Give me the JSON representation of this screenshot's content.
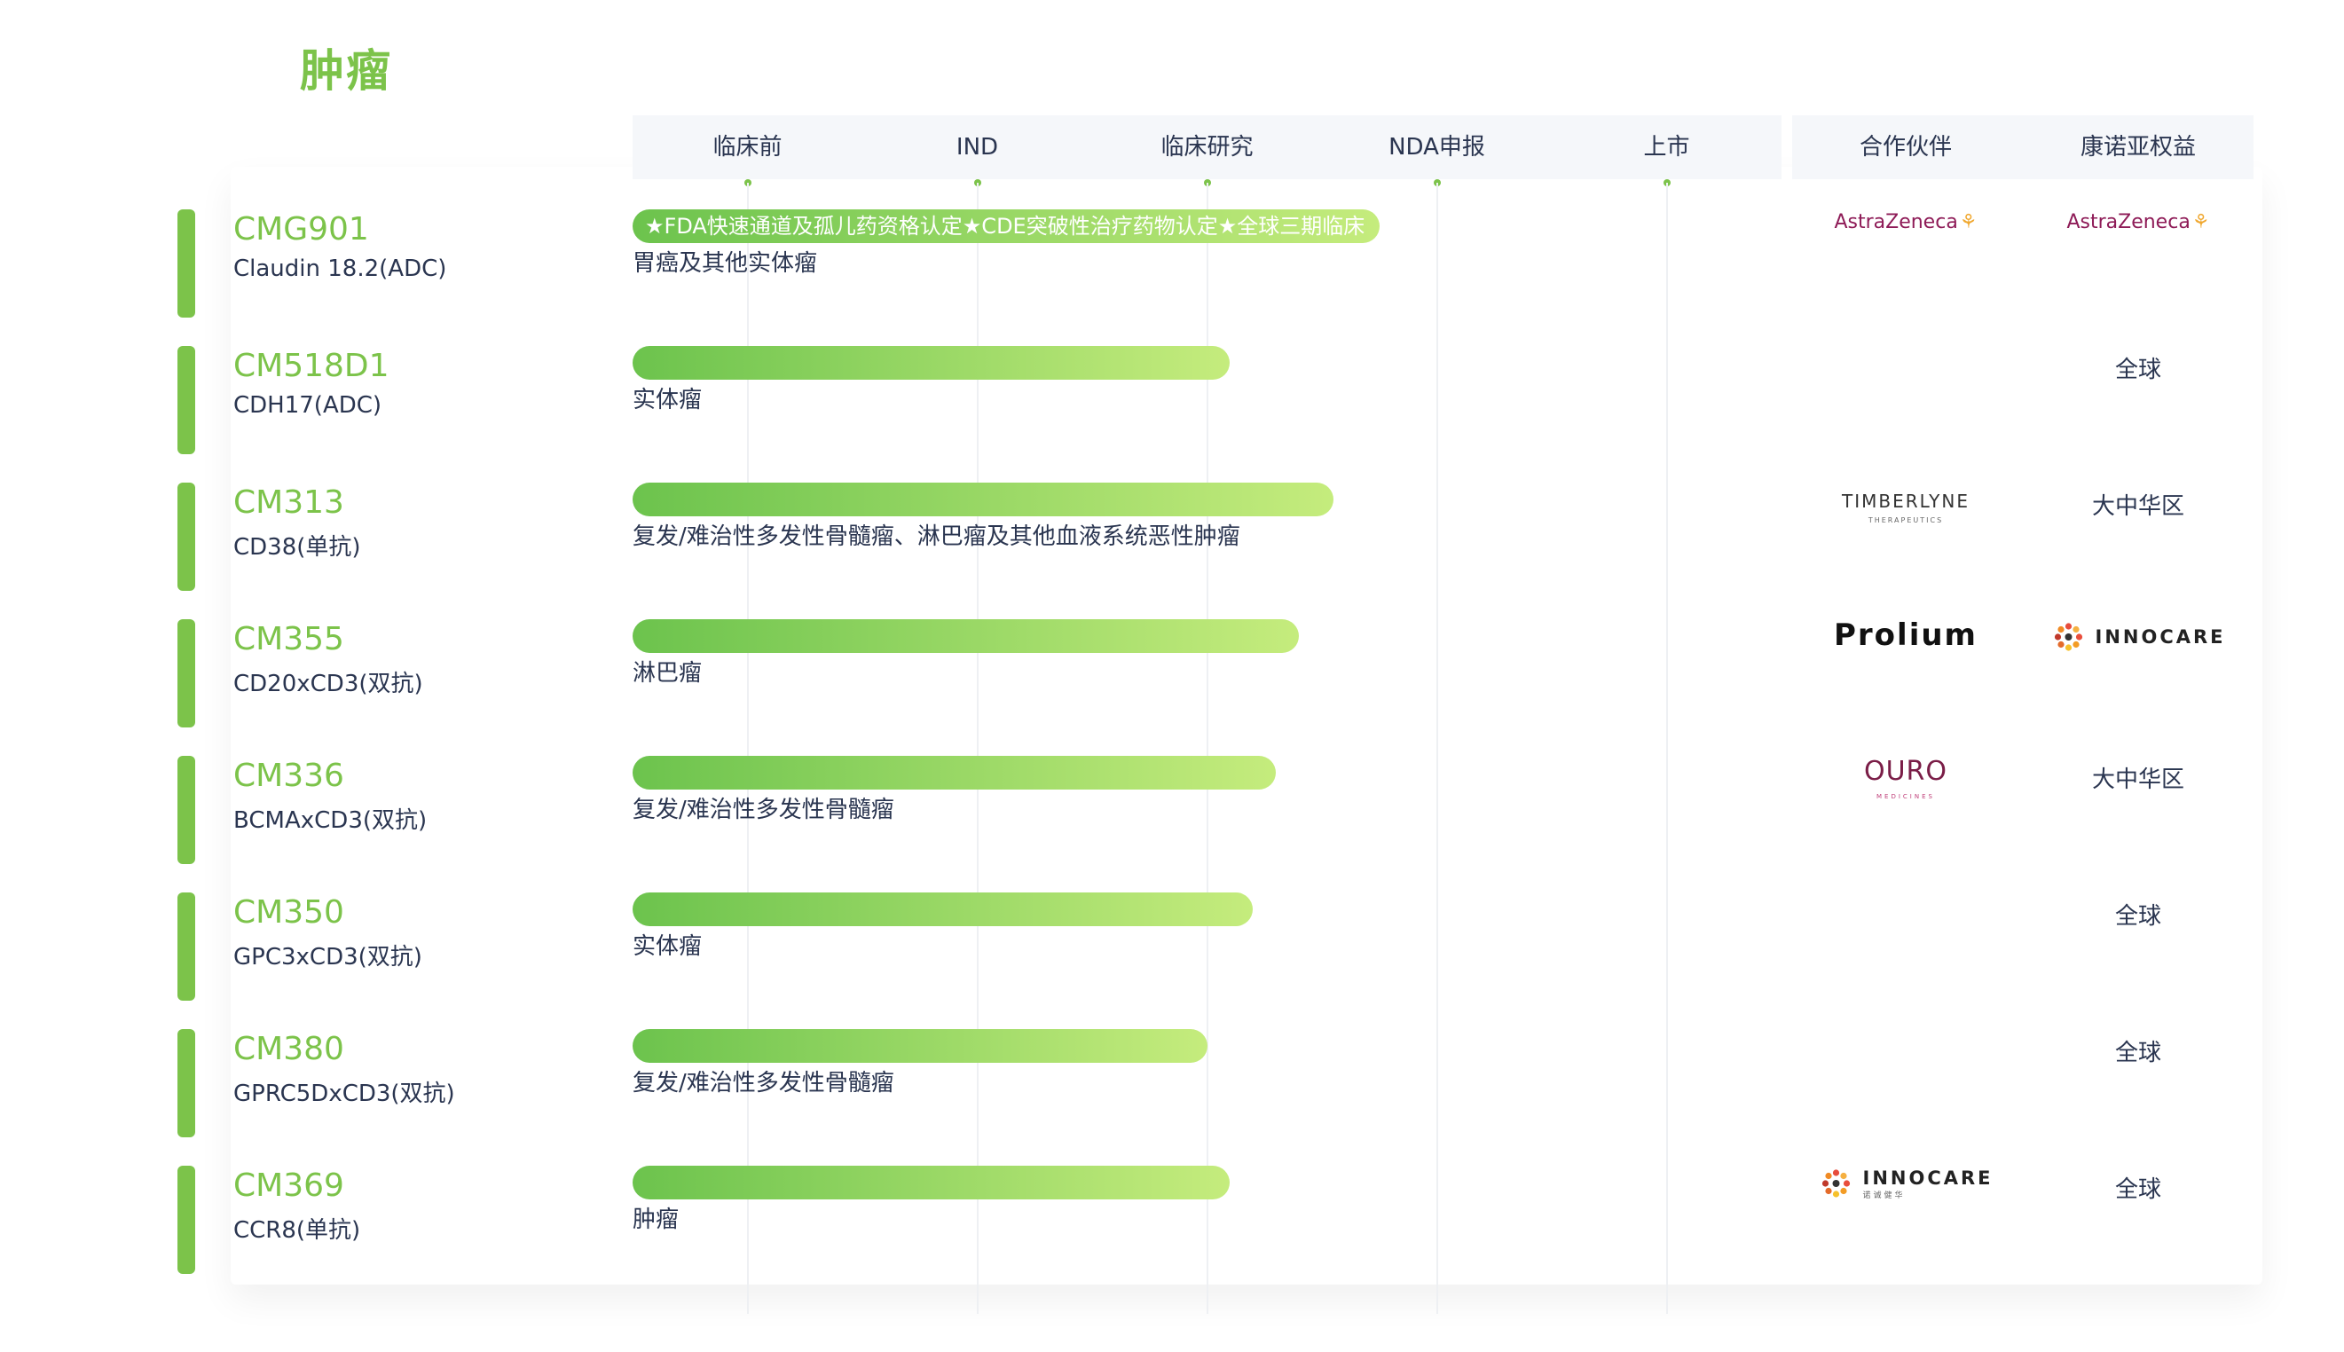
{
  "section_title": "肿瘤",
  "chart_data": {
    "type": "bar",
    "orientation": "horizontal",
    "phases": [
      "临床前",
      "IND",
      "临床研究",
      "NDA申报",
      "上市"
    ],
    "extra_columns": [
      "合作伙伴",
      "康诺亚权益"
    ],
    "xlim": [
      0,
      5
    ],
    "rows": [
      {
        "code": "CMG901",
        "target": "Claudin 18.2(ADC)",
        "progress": 3.25,
        "bar_label": "★FDA快速通道及孤儿药资格认定★CDE突破性治疗药物认定★全球三期临床",
        "indication": "胃癌及其他实体瘤",
        "partner": "AstraZeneca",
        "rights": "AstraZeneca"
      },
      {
        "code": "CM518D1",
        "target": "CDH17(ADC)",
        "progress": 2.6,
        "bar_label": "",
        "indication": "实体瘤",
        "partner": "",
        "rights": "全球"
      },
      {
        "code": "CM313",
        "target": "CD38(单抗)",
        "progress": 3.05,
        "bar_label": "",
        "indication": "复发/难治性多发性骨髓瘤、淋巴瘤及其他血液系统恶性肿瘤",
        "partner": "TIMBERLYNE",
        "rights": "大中华区"
      },
      {
        "code": "CM355",
        "target": "CD20xCD3(双抗)",
        "progress": 2.9,
        "bar_label": "",
        "indication": "淋巴瘤",
        "partner": "Prolium",
        "rights": "INNOCARE"
      },
      {
        "code": "CM336",
        "target": "BCMAxCD3(双抗)",
        "progress": 2.8,
        "bar_label": "",
        "indication": "复发/难治性多发性骨髓瘤",
        "partner": "OURO",
        "rights": "大中华区"
      },
      {
        "code": "CM350",
        "target": "GPC3xCD3(双抗)",
        "progress": 2.7,
        "bar_label": "",
        "indication": "实体瘤",
        "partner": "",
        "rights": "全球"
      },
      {
        "code": "CM380",
        "target": "GPRC5DxCD3(双抗)",
        "progress": 2.5,
        "bar_label": "",
        "indication": "复发/难治性多发性骨髓瘤",
        "partner": "",
        "rights": "全球"
      },
      {
        "code": "CM369",
        "target": "CCR8(单抗)",
        "progress": 2.6,
        "bar_label": "",
        "indication": "肿瘤",
        "partner": "INNOCARE",
        "rights": "全球"
      }
    ]
  },
  "colors": {
    "accent": "#7cc34a",
    "bar_start": "#6cc34d",
    "bar_end": "#c5ec7d",
    "text": "#2a3550"
  },
  "logos": {
    "astrazeneca": {
      "name": "AstraZeneca",
      "icon": "az-swirl-icon"
    },
    "timberlyne": {
      "name": "TIMBERLYNE",
      "sub": "THERAPEUTICS"
    },
    "prolium": {
      "name": "Prolium"
    },
    "duro": {
      "name": "OURO",
      "sub": "MEDICINES"
    },
    "innocare": {
      "name": "INNOCARE",
      "sub": "诺诚健华",
      "icon": "innocare-flower-icon"
    }
  }
}
